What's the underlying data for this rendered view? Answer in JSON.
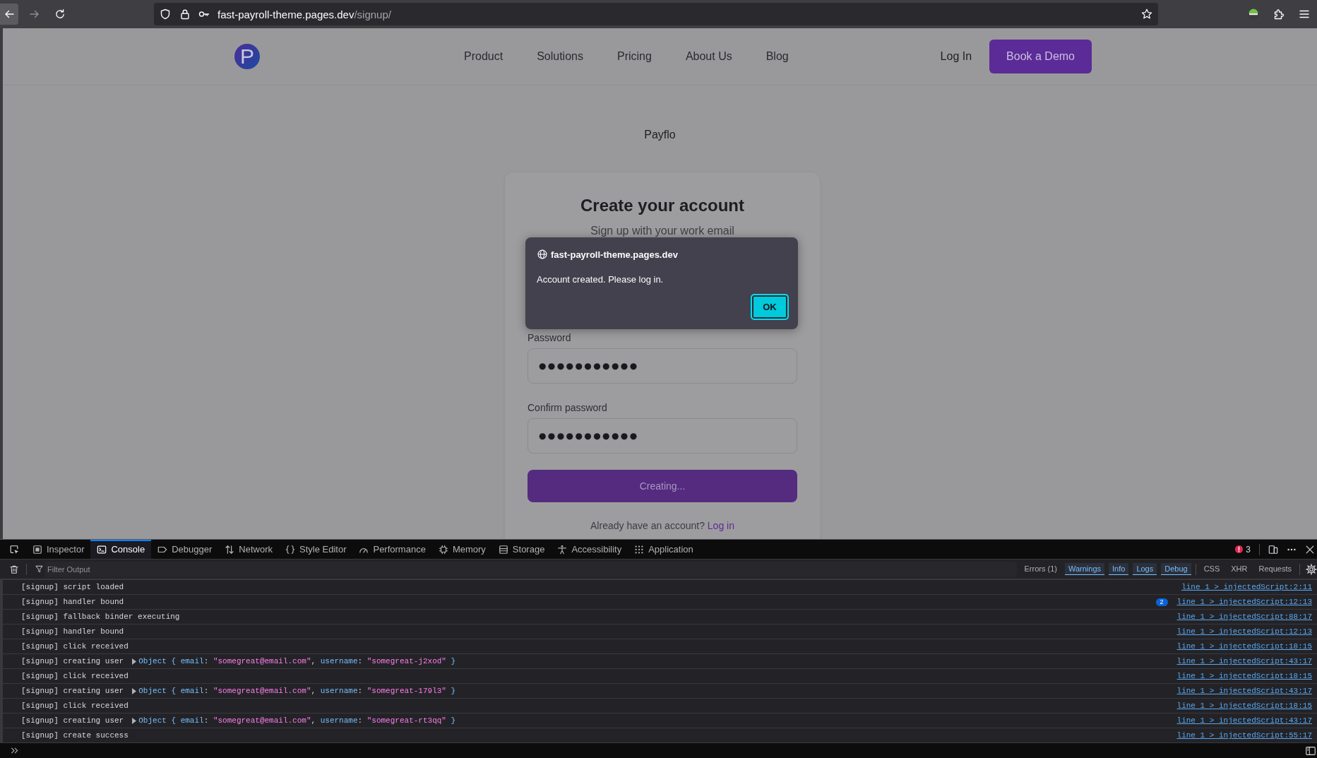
{
  "browser_toolbar": {
    "nav_buttons": [
      {
        "kind": "back",
        "disabled": false,
        "highlighted": true
      },
      {
        "kind": "forward",
        "disabled": true,
        "highlighted": false
      },
      {
        "kind": "reload",
        "disabled": false,
        "highlighted": false
      }
    ],
    "url": {
      "host": "fast-payroll-theme.pages.dev",
      "path": "/signup/"
    }
  },
  "site_header": {
    "logo_letter": "P",
    "nav_links": [
      "Product",
      "Solutions",
      "Pricing",
      "About Us",
      "Blog"
    ],
    "login_link": "Log In",
    "cta_button": "Book a Demo"
  },
  "brand_name": "Payflo",
  "signup_card": {
    "title": "Create your account",
    "subtitle": "Sign up with your work email",
    "fields": [
      {
        "label": "Password",
        "value": "●●●●●●●●●●●"
      },
      {
        "label": "Confirm password",
        "value": "●●●●●●●●●●●"
      }
    ],
    "submit_button": {
      "label": "Creating...",
      "disabled": true
    },
    "footer": {
      "text": "Already have an account?",
      "link": "Log in"
    }
  },
  "alert_dialog": {
    "origin": "fast-payroll-theme.pages.dev",
    "message": "Account created. Please log in.",
    "ok_button": {
      "label": "OK",
      "focused": true
    }
  },
  "devtools": {
    "tabs": [
      {
        "label": "Inspector",
        "selected": false
      },
      {
        "label": "Console",
        "selected": true
      },
      {
        "label": "Debugger",
        "selected": false
      },
      {
        "label": "Network",
        "selected": false
      },
      {
        "label": "Style Editor",
        "selected": false
      },
      {
        "label": "Performance",
        "selected": false
      },
      {
        "label": "Memory",
        "selected": false
      },
      {
        "label": "Storage",
        "selected": false
      },
      {
        "label": "Accessibility",
        "selected": false
      },
      {
        "label": "Application",
        "selected": false
      }
    ],
    "error_count": "3",
    "filter_field": {
      "placeholder": "Filter Output"
    },
    "level_filters": [
      {
        "label": "Errors (1)",
        "selected": false
      },
      {
        "label": "Warnings",
        "selected": true
      },
      {
        "label": "Info",
        "selected": true
      },
      {
        "label": "Logs",
        "selected": true
      },
      {
        "label": "Debug",
        "selected": true
      }
    ],
    "request_filters": [
      {
        "label": "CSS",
        "selected": false
      },
      {
        "label": "XHR",
        "selected": false
      },
      {
        "label": "Requests",
        "selected": false
      }
    ],
    "console_rows": [
      {
        "message": "[signup] script loaded",
        "source": "line 1 > injectedScript:2:11"
      },
      {
        "message": "[signup] handler bound",
        "repeat": "2",
        "source": "line 1 > injectedScript:12:13"
      },
      {
        "message": "[signup] fallback binder executing",
        "source": "line 1 > injectedScript:88:17"
      },
      {
        "message": "[signup] handler bound",
        "source": "line 1 > injectedScript:12:13"
      },
      {
        "message": "[signup] click received",
        "source": "line 1 > injectedScript:18:15"
      },
      {
        "message": "[signup] creating user",
        "object_preview": [
          {
            "kind": "type",
            "text": "Object "
          },
          {
            "kind": "brace",
            "text": "{ "
          },
          {
            "kind": "key",
            "text": "email"
          },
          {
            "kind": "sep",
            "text": ": "
          },
          {
            "kind": "string",
            "text": "\"somegreat@email.com\""
          },
          {
            "kind": "sep",
            "text": ", "
          },
          {
            "kind": "key",
            "text": "username"
          },
          {
            "kind": "sep",
            "text": ": "
          },
          {
            "kind": "string",
            "text": "\"somegreat-j2xod\""
          },
          {
            "kind": "brace",
            "text": " }"
          }
        ],
        "source": "line 1 > injectedScript:43:17"
      },
      {
        "message": "[signup] click received",
        "source": "line 1 > injectedScript:18:15"
      },
      {
        "message": "[signup] creating user",
        "object_preview": [
          {
            "kind": "type",
            "text": "Object "
          },
          {
            "kind": "brace",
            "text": "{ "
          },
          {
            "kind": "key",
            "text": "email"
          },
          {
            "kind": "sep",
            "text": ": "
          },
          {
            "kind": "string",
            "text": "\"somegreat@email.com\""
          },
          {
            "kind": "sep",
            "text": ", "
          },
          {
            "kind": "key",
            "text": "username"
          },
          {
            "kind": "sep",
            "text": ": "
          },
          {
            "kind": "string",
            "text": "\"somegreat-179l3\""
          },
          {
            "kind": "brace",
            "text": " }"
          }
        ],
        "source": "line 1 > injectedScript:43:17"
      },
      {
        "message": "[signup] click received",
        "source": "line 1 > injectedScript:18:15"
      },
      {
        "message": "[signup] creating user",
        "object_preview": [
          {
            "kind": "type",
            "text": "Object "
          },
          {
            "kind": "brace",
            "text": "{ "
          },
          {
            "kind": "key",
            "text": "email"
          },
          {
            "kind": "sep",
            "text": ": "
          },
          {
            "kind": "string",
            "text": "\"somegreat@email.com\""
          },
          {
            "kind": "sep",
            "text": ", "
          },
          {
            "kind": "key",
            "text": "username"
          },
          {
            "kind": "sep",
            "text": ": "
          },
          {
            "kind": "string",
            "text": "\"somegreat-rt3qq\""
          },
          {
            "kind": "brace",
            "text": " }"
          }
        ],
        "source": "line 1 > injectedScript:43:17"
      },
      {
        "message": "[signup] create success",
        "source": "line 1 > injectedScript:55:17"
      }
    ]
  }
}
